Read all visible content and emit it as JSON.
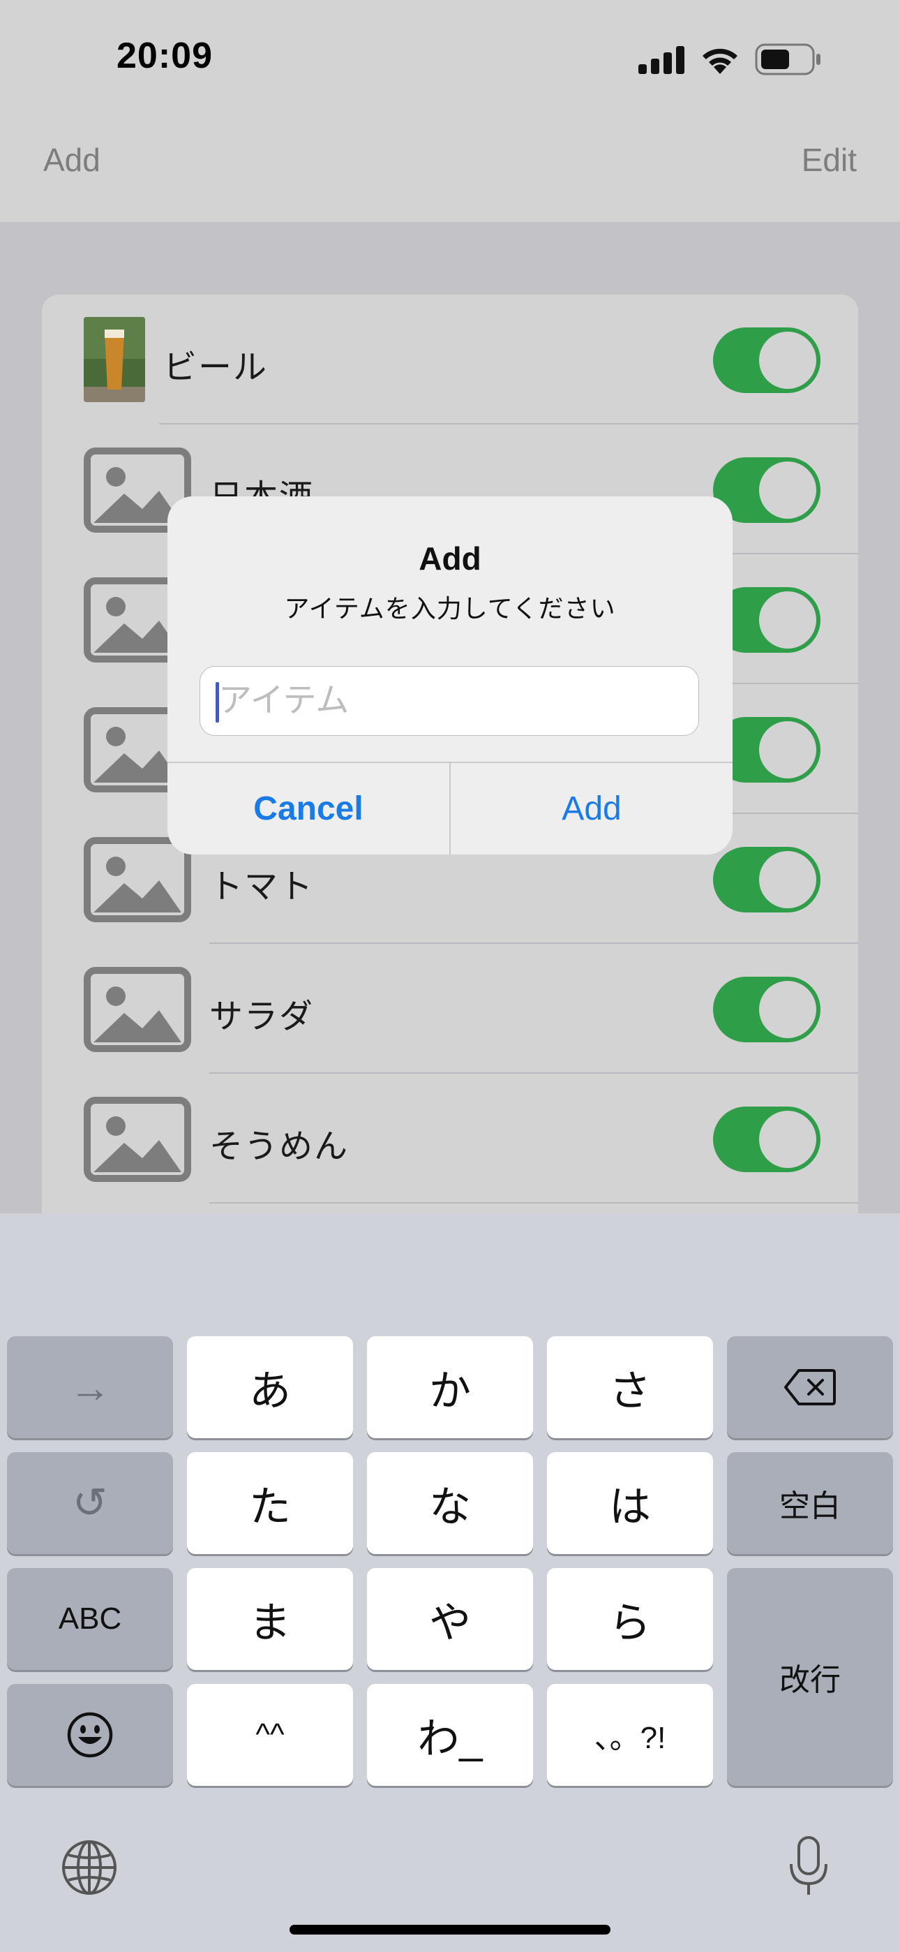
{
  "status_bar": {
    "time": "20:09"
  },
  "nav": {
    "add_label": "Add",
    "edit_label": "Edit"
  },
  "list": {
    "items": [
      {
        "label": "ビール",
        "enabled": true,
        "has_photo": true
      },
      {
        "label": "日本酒",
        "enabled": true,
        "has_photo": false
      },
      {
        "label": "",
        "enabled": true,
        "has_photo": false
      },
      {
        "label": "",
        "enabled": true,
        "has_photo": false
      },
      {
        "label": "トマト",
        "enabled": true,
        "has_photo": false
      },
      {
        "label": "サラダ",
        "enabled": true,
        "has_photo": false
      },
      {
        "label": "そうめん",
        "enabled": true,
        "has_photo": false
      }
    ]
  },
  "alert": {
    "title": "Add",
    "message": "アイテムを入力してください",
    "input_value": "",
    "input_placeholder": "アイテム",
    "cancel_label": "Cancel",
    "confirm_label": "Add"
  },
  "keyboard": {
    "rows": [
      [
        "→",
        "あ",
        "か",
        "さ",
        "⌫"
      ],
      [
        "↺",
        "た",
        "な",
        "は",
        "空白"
      ],
      [
        "ABC",
        "ま",
        "や",
        "ら",
        "改行"
      ],
      [
        "☺",
        "^^",
        "わ_",
        "、。?!"
      ]
    ]
  },
  "colors": {
    "toggle_on": "#2f9e49",
    "link_blue": "#1a7ae6",
    "caret": "#3b5bdb"
  }
}
